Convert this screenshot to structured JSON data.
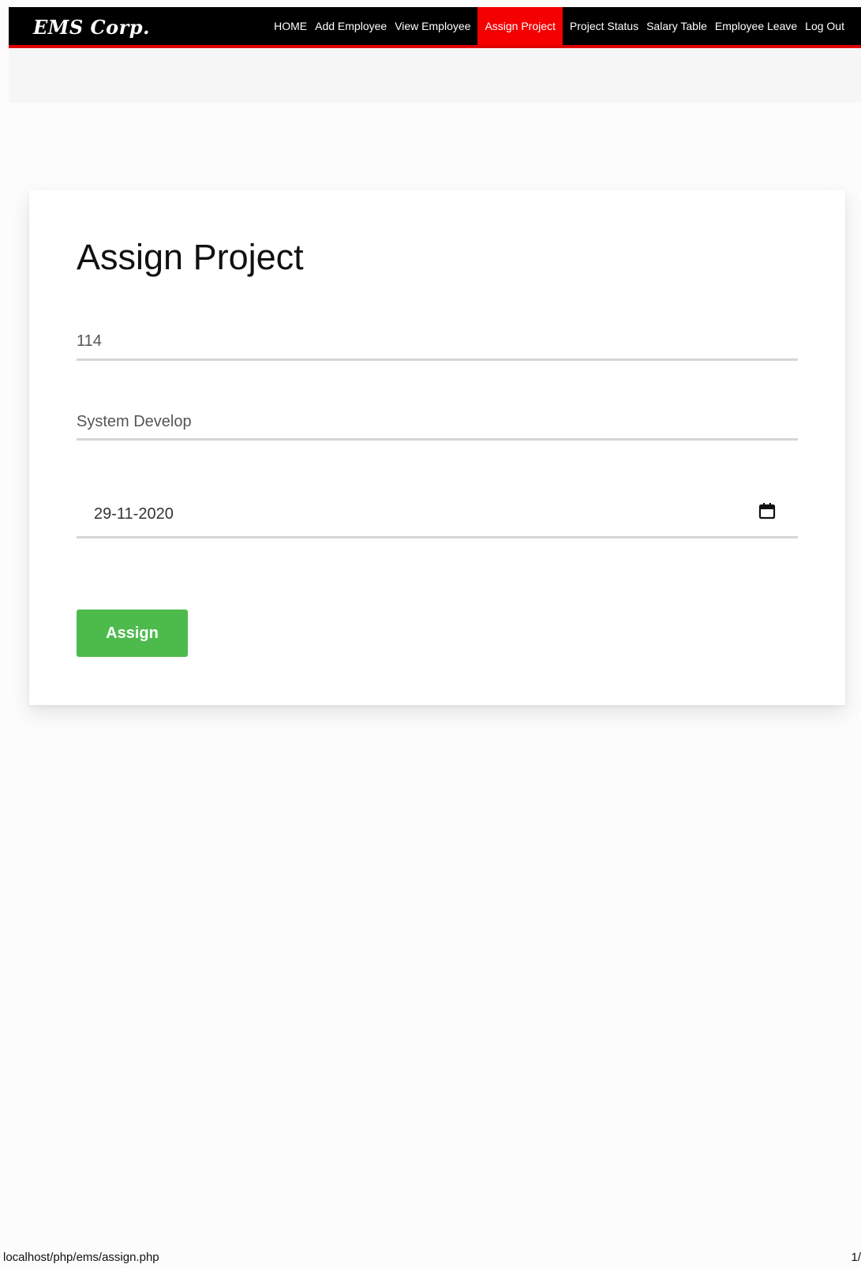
{
  "navbar": {
    "logo": "EMS Corp.",
    "links": [
      {
        "label": "HOME",
        "active": false
      },
      {
        "label": "Add Employee",
        "active": false
      },
      {
        "label": "View Employee",
        "active": false
      },
      {
        "label": "Assign Project",
        "active": true
      },
      {
        "label": "Project Status",
        "active": false
      },
      {
        "label": "Salary Table",
        "active": false
      },
      {
        "label": "Employee Leave",
        "active": false
      },
      {
        "label": "Log Out",
        "active": false
      }
    ]
  },
  "colors": {
    "nav_bg": "#000000",
    "accent": "#f40000",
    "button": "#4cbb4c"
  },
  "form": {
    "title": "Assign Project",
    "employee_id": "114",
    "project_name": "System Develop",
    "due_date": "29-11-2020",
    "date_icon": "calendar-icon",
    "submit_label": "Assign"
  },
  "footer": {
    "url": "localhost/php/ems/assign.php",
    "page": "1/"
  }
}
